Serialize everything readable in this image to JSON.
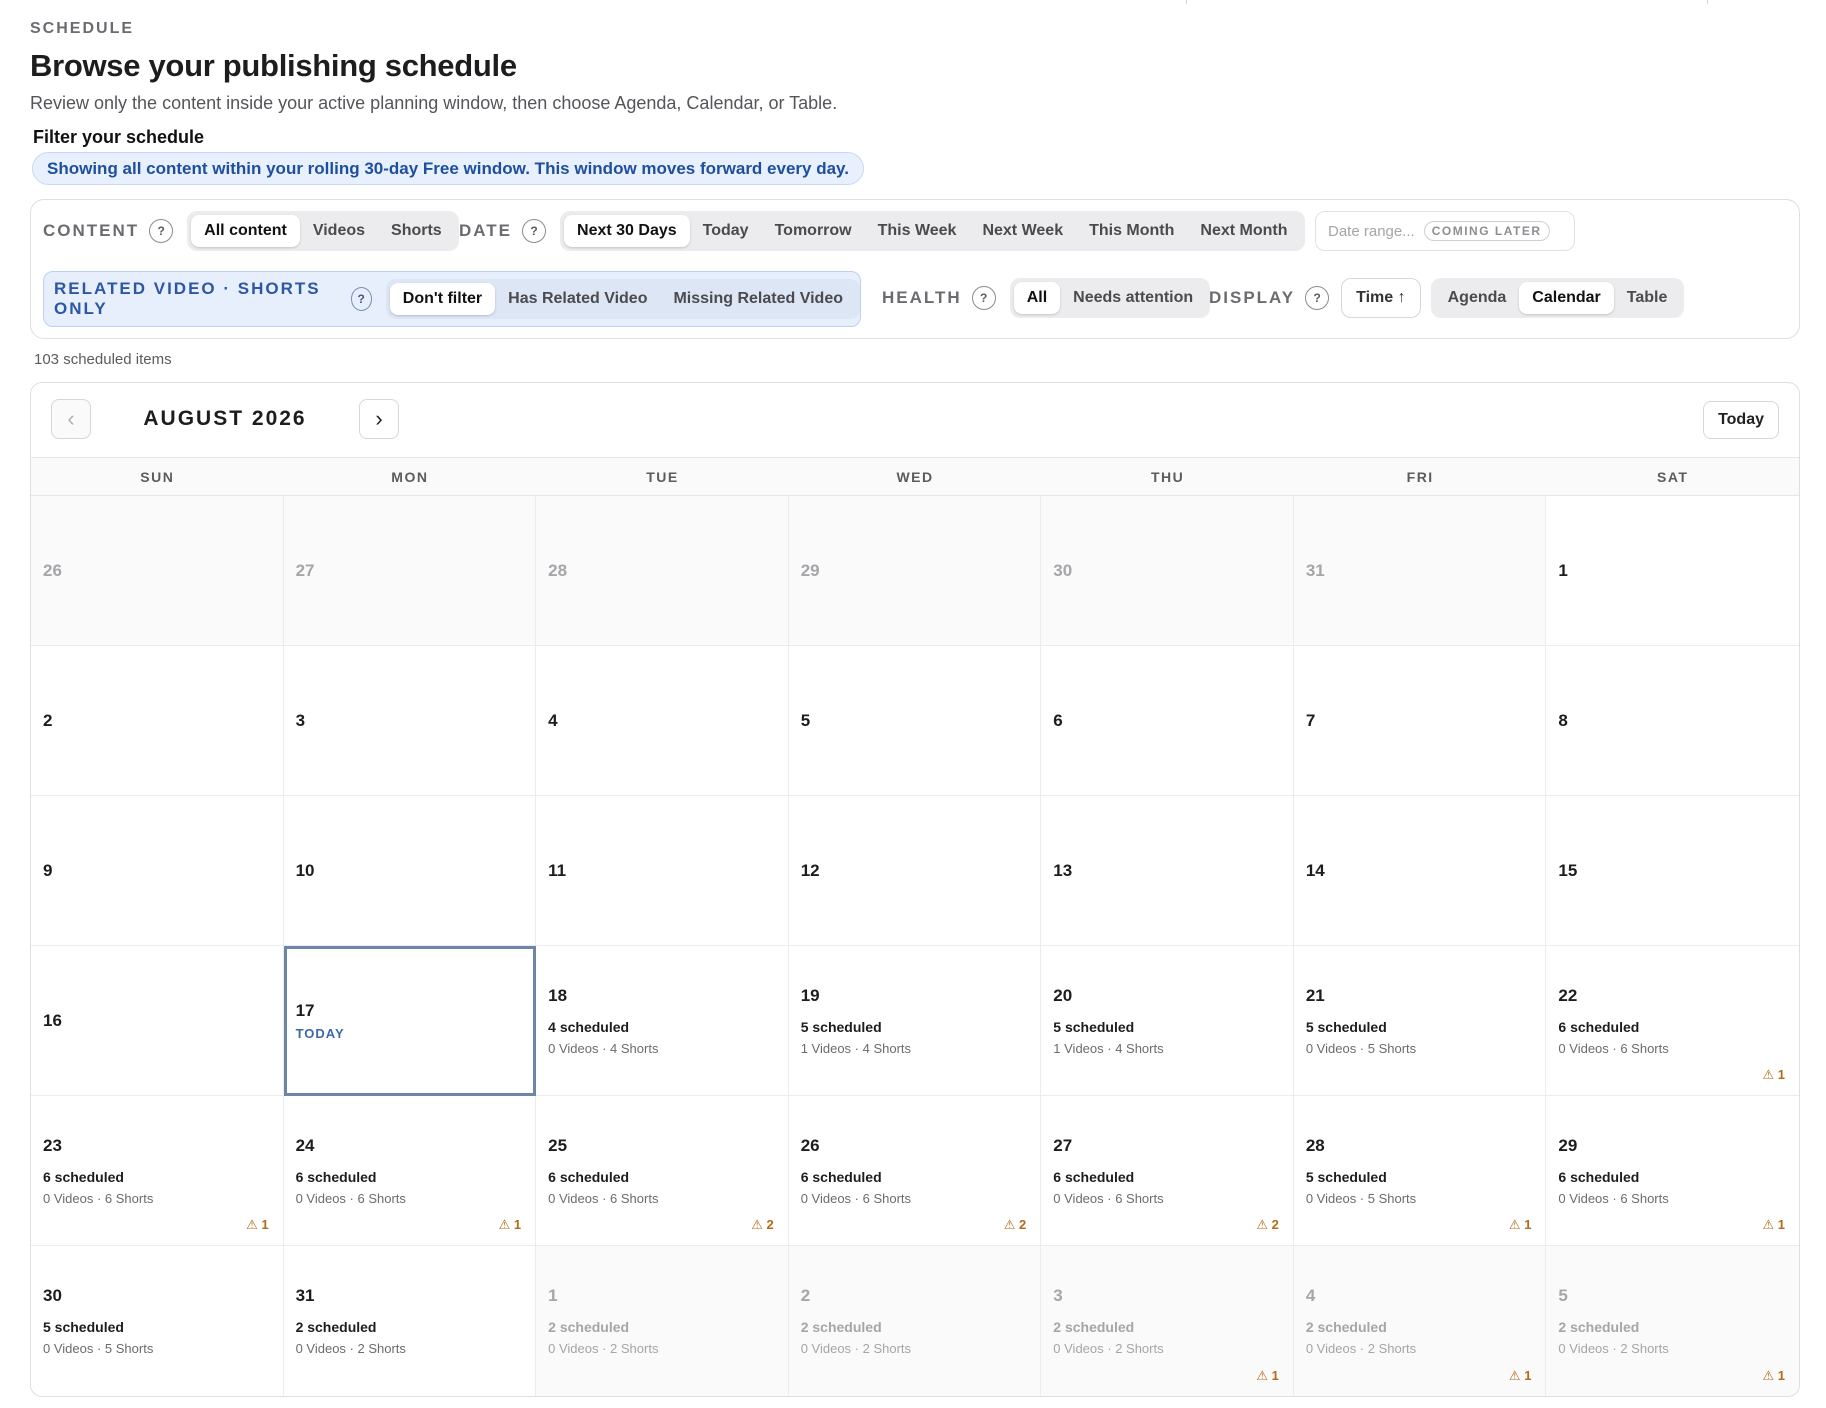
{
  "header": {
    "eyebrow": "SCHEDULE",
    "title": "Browse your publishing schedule",
    "subtitle": "Review only the content inside your active planning window, then choose Agenda, Calendar, or Table."
  },
  "filters": {
    "heading": "Filter your schedule",
    "banner": "Showing all content within your rolling 30-day Free window. This window moves forward every day.",
    "content": {
      "label": "CONTENT",
      "options": [
        "All content",
        "Videos",
        "Shorts"
      ],
      "selected": "All content"
    },
    "date": {
      "label": "DATE",
      "options": [
        "Next 30 Days",
        "Today",
        "Tomorrow",
        "This Week",
        "Next Week",
        "This Month",
        "Next Month"
      ],
      "selected": "Next 30 Days"
    },
    "date_range": {
      "placeholder": "Date range...",
      "badge": "COMING LATER"
    },
    "related": {
      "label": "RELATED VIDEO · SHORTS ONLY",
      "options": [
        "Don't filter",
        "Has Related Video",
        "Missing Related Video"
      ],
      "selected": "Don't filter"
    },
    "health": {
      "label": "HEALTH",
      "options": [
        "All",
        "Needs attention"
      ],
      "selected": "All"
    },
    "display": {
      "label": "DISPLAY",
      "sort": "Time ↑",
      "options": [
        "Agenda",
        "Calendar",
        "Table"
      ],
      "selected": "Calendar"
    },
    "help": "?"
  },
  "count_label": "103 scheduled items",
  "calendar": {
    "month": "AUGUST 2026",
    "prev": "‹",
    "next": "›",
    "today_label": "Today",
    "weekdays": [
      "SUN",
      "MON",
      "TUE",
      "WED",
      "THU",
      "FRI",
      "SAT"
    ],
    "today_tag": "TODAY",
    "days": [
      {
        "n": "26",
        "out": true
      },
      {
        "n": "27",
        "out": true
      },
      {
        "n": "28",
        "out": true
      },
      {
        "n": "29",
        "out": true
      },
      {
        "n": "30",
        "out": true
      },
      {
        "n": "31",
        "out": true
      },
      {
        "n": "1"
      },
      {
        "n": "2"
      },
      {
        "n": "3"
      },
      {
        "n": "4"
      },
      {
        "n": "5"
      },
      {
        "n": "6"
      },
      {
        "n": "7"
      },
      {
        "n": "8"
      },
      {
        "n": "9"
      },
      {
        "n": "10"
      },
      {
        "n": "11"
      },
      {
        "n": "12"
      },
      {
        "n": "13"
      },
      {
        "n": "14"
      },
      {
        "n": "15"
      },
      {
        "n": "16"
      },
      {
        "n": "17",
        "today": true
      },
      {
        "n": "18",
        "s": "4 scheduled",
        "b": "0 Videos · 4 Shorts"
      },
      {
        "n": "19",
        "s": "5 scheduled",
        "b": "1 Videos · 4 Shorts"
      },
      {
        "n": "20",
        "s": "5 scheduled",
        "b": "1 Videos · 4 Shorts"
      },
      {
        "n": "21",
        "s": "5 scheduled",
        "b": "0 Videos · 5 Shorts"
      },
      {
        "n": "22",
        "s": "6 scheduled",
        "b": "0 Videos · 6 Shorts",
        "w": "⚠ 1"
      },
      {
        "n": "23",
        "s": "6 scheduled",
        "b": "0 Videos · 6 Shorts",
        "w": "⚠ 1"
      },
      {
        "n": "24",
        "s": "6 scheduled",
        "b": "0 Videos · 6 Shorts",
        "w": "⚠ 1"
      },
      {
        "n": "25",
        "s": "6 scheduled",
        "b": "0 Videos · 6 Shorts",
        "w": "⚠ 2"
      },
      {
        "n": "26",
        "s": "6 scheduled",
        "b": "0 Videos · 6 Shorts",
        "w": "⚠ 2"
      },
      {
        "n": "27",
        "s": "6 scheduled",
        "b": "0 Videos · 6 Shorts",
        "w": "⚠ 2"
      },
      {
        "n": "28",
        "s": "5 scheduled",
        "b": "0 Videos · 5 Shorts",
        "w": "⚠ 1"
      },
      {
        "n": "29",
        "s": "6 scheduled",
        "b": "0 Videos · 6 Shorts",
        "w": "⚠ 1"
      },
      {
        "n": "30",
        "s": "5 scheduled",
        "b": "0 Videos · 5 Shorts"
      },
      {
        "n": "31",
        "s": "2 scheduled",
        "b": "0 Videos · 2 Shorts"
      },
      {
        "n": "1",
        "out": true,
        "s": "2 scheduled",
        "b": "0 Videos · 2 Shorts"
      },
      {
        "n": "2",
        "out": true,
        "s": "2 scheduled",
        "b": "0 Videos · 2 Shorts"
      },
      {
        "n": "3",
        "out": true,
        "s": "2 scheduled",
        "b": "0 Videos · 2 Shorts",
        "w": "⚠ 1"
      },
      {
        "n": "4",
        "out": true,
        "s": "2 scheduled",
        "b": "0 Videos · 2 Shorts",
        "w": "⚠ 1"
      },
      {
        "n": "5",
        "out": true,
        "s": "2 scheduled",
        "b": "0 Videos · 2 Shorts",
        "w": "⚠ 1"
      }
    ]
  }
}
